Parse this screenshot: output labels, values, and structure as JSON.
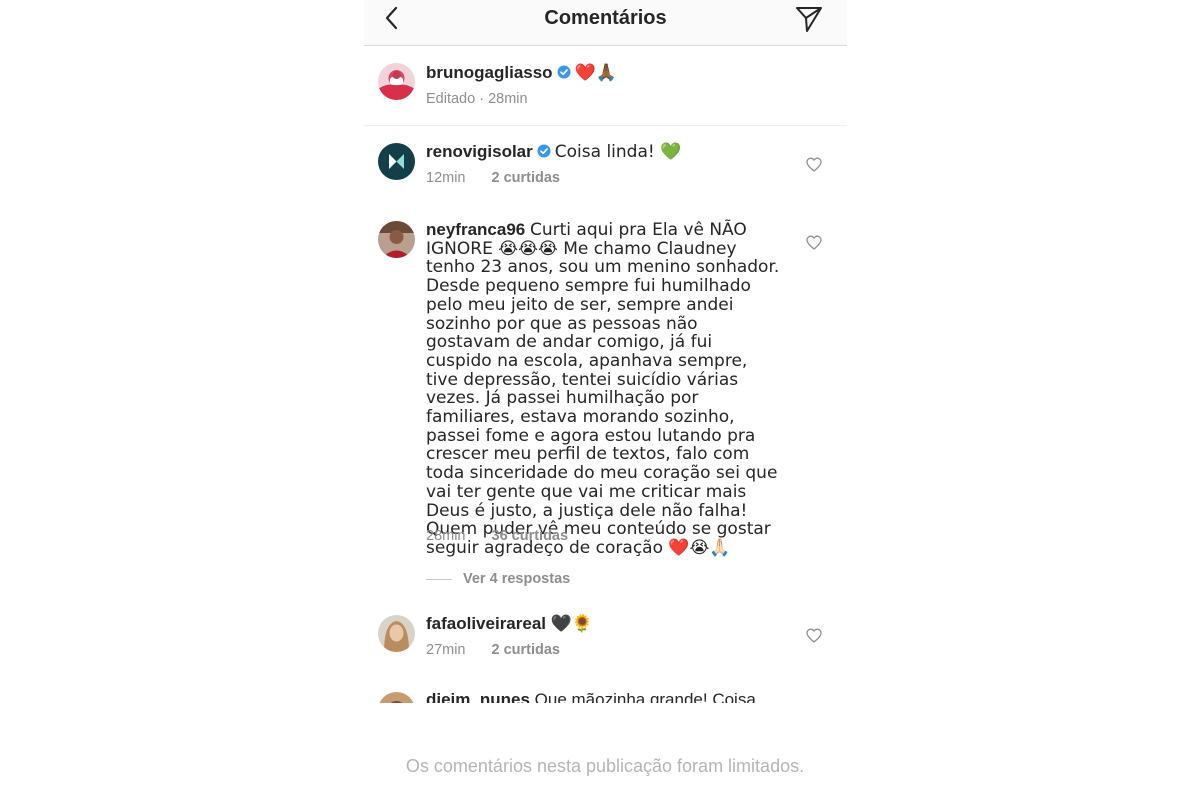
{
  "header": {
    "title": "Comentários"
  },
  "caption": {
    "username": "brunogagliasso",
    "emoji": "❤️🙏🏾",
    "edited": "Editado",
    "time": "28min"
  },
  "comments": [
    {
      "username": "renovigisolar",
      "text": "Coisa linda! 💚",
      "time": "12min",
      "likes": "2 curtidas"
    },
    {
      "username": "neyfranca96",
      "text": "Curti aqui pra Ela vê NÃO IGNORE 😭😭😭 Me chamo Claudney tenho 23 anos, sou um menino sonhador. Desde pequeno sempre fui humilhado pelo meu jeito de ser, sempre andei sozinho por que as pessoas não gostavam de andar comigo, já fui cuspido na escola, apanhava sempre, tive depressão, tentei suicídio várias vezes. Já passei humilhação por familiares, estava morando sozinho, passei fome e agora estou lutando pra crescer meu perfil de textos, falo com toda sinceridade do meu coração sei que vai ter gente que vai me criticar mais Deus é justo, a justiça dele não falha! Quem puder vê meu conteúdo se gostar seguir agradeço de coração ❤️😭🙏🏻",
      "time": "28min",
      "likes": "36 curtidas",
      "replies": "Ver 4 respostas"
    },
    {
      "username": "fafaoliveirareal",
      "text": "🖤🌻",
      "time": "27min",
      "likes": "2 curtidas"
    },
    {
      "username": "djeim_nunes",
      "text": "Que mãozinha grande! Coisa"
    }
  ],
  "footer": {
    "notice": "Os comentários nesta publicação foram limitados."
  },
  "icons": [
    "back-arrow-icon",
    "send-icon",
    "verified-badge-icon",
    "heart-outline-icon"
  ],
  "colors": {
    "verified": "#3897f0",
    "meta": "#8e8e8e",
    "text": "#262626"
  }
}
